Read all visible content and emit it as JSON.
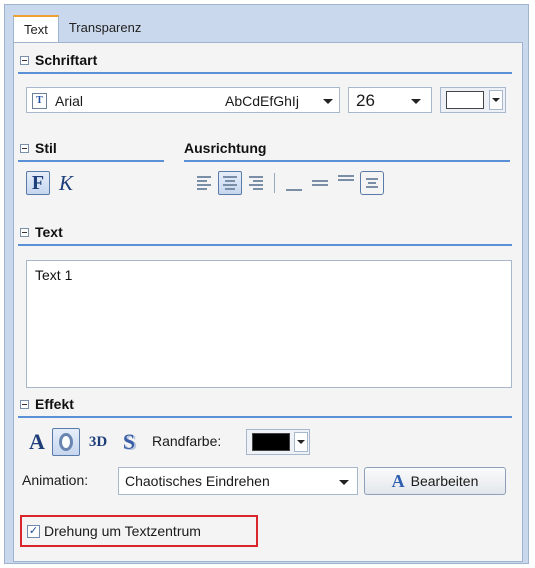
{
  "tabs": [
    "Text",
    "Transparenz"
  ],
  "sections": {
    "font": "Schriftart",
    "style": "Stil",
    "align": "Ausrichtung",
    "text": "Text",
    "effect": "Effekt"
  },
  "font": {
    "name": "Arial",
    "preview": "AbCdEfGhIj",
    "size": "26",
    "color": "#ffffff"
  },
  "style_buttons": {
    "bold_glyph": "F",
    "italic_glyph": "K"
  },
  "text_content": "Text 1",
  "effect": {
    "plain_glyph": "A",
    "threed_label": "3D",
    "shadow_glyph": "S",
    "border_color_label": "Randfarbe:",
    "border_color": "#000000"
  },
  "animation": {
    "label": "Animation:",
    "value": "Chaotisches Eindrehen",
    "edit_button": "Bearbeiten"
  },
  "rotation": {
    "label": "Drehung um Textzentrum",
    "checked": true,
    "check_glyph": "✓"
  },
  "colors": {
    "accent_line": "#5b8fd6",
    "highlight": "#d8262b"
  }
}
